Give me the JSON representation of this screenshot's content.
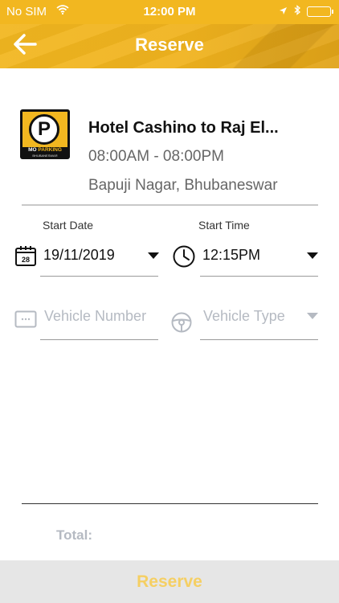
{
  "status_bar": {
    "carrier": "No SIM",
    "time": "12:00 PM"
  },
  "header": {
    "title": "Reserve",
    "back_icon": "arrow-left-icon"
  },
  "parking": {
    "logo_letter": "P",
    "logo_band_mo": "MO",
    "logo_band_parking": "PARKING",
    "logo_sub": "BHUBANESWAR",
    "name": "Hotel Cashino to Raj El...",
    "hours": "08:00AM - 08:00PM",
    "address": "Bapuji Nagar, Bhubaneswar"
  },
  "form": {
    "start_date": {
      "label": "Start Date",
      "value": "19/11/2019",
      "icon": "calendar-icon",
      "icon_day": "28"
    },
    "start_time": {
      "label": "Start Time",
      "value": "12:15PM",
      "icon": "clock-icon"
    },
    "vehicle_number": {
      "placeholder": "Vehicle Number",
      "icon": "license-plate-icon"
    },
    "vehicle_type": {
      "placeholder": "Vehicle Type",
      "icon": "steering-wheel-icon"
    }
  },
  "footer": {
    "total_label": "Total:",
    "reserve_label": "Reserve"
  },
  "colors": {
    "brand_yellow": "#f2b720",
    "placeholder_gray": "#b5bac2",
    "reserve_disabled_text": "#f5cf63",
    "reserve_bar_bg": "#e6e6e6"
  }
}
